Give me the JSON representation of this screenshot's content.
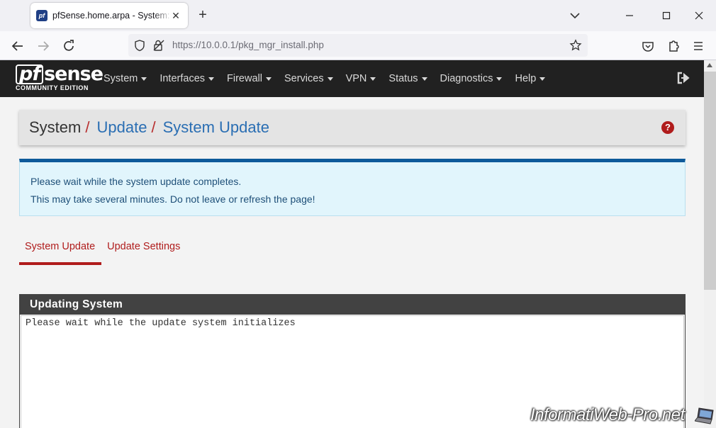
{
  "browser": {
    "tab_title": "pfSense.home.arpa - System: Update: System Update",
    "favicon_text": "pf",
    "url_host": "https://10.0.0.1",
    "url_path": "/pkg_mgr_install.php"
  },
  "header": {
    "logo_main": "sense",
    "logo_pf": "pf",
    "logo_sub": "COMMUNITY EDITION",
    "menu": [
      "System",
      "Interfaces",
      "Firewall",
      "Services",
      "VPN",
      "Status",
      "Diagnostics",
      "Help"
    ]
  },
  "breadcrumb": {
    "system": "System",
    "sep": "/",
    "update": "Update",
    "system_update": "System Update",
    "help_glyph": "?"
  },
  "alert": {
    "line1": "Please wait while the system update completes.",
    "line2": "This may take several minutes. Do not leave or refresh the page!"
  },
  "tabs": [
    "System Update",
    "Update Settings"
  ],
  "panel": {
    "title": "Updating System",
    "output": "Please wait while the update system initializes"
  },
  "watermark": "InformatiWeb-Pro.net",
  "colors": {
    "pf_red": "#b01c1c",
    "link_blue": "#2a6eb3",
    "header_dark": "#212121",
    "alert_bg": "#e1f5fc"
  }
}
